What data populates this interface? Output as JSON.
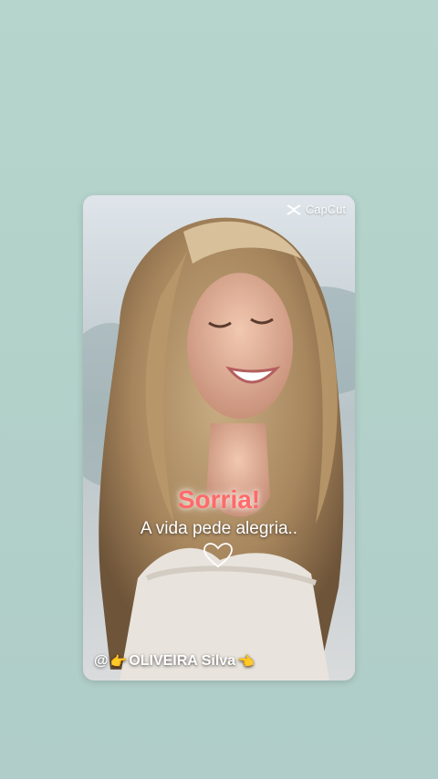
{
  "watermark": {
    "label": "CapCut",
    "icon": "capcut-logo-icon"
  },
  "overlay": {
    "headline": "Sorria!",
    "subtitle": "A vida pede alegria..",
    "heart_icon": "heart-outline-icon"
  },
  "credit": {
    "prefix": "@",
    "hand_left": "👉",
    "name": "OLIVEIRA Silva",
    "hand_right": "👈"
  },
  "colors": {
    "background": "#b3d3cb",
    "headline": "#ff6a6a",
    "text": "#ffffff",
    "hand": "#ffc83d"
  }
}
